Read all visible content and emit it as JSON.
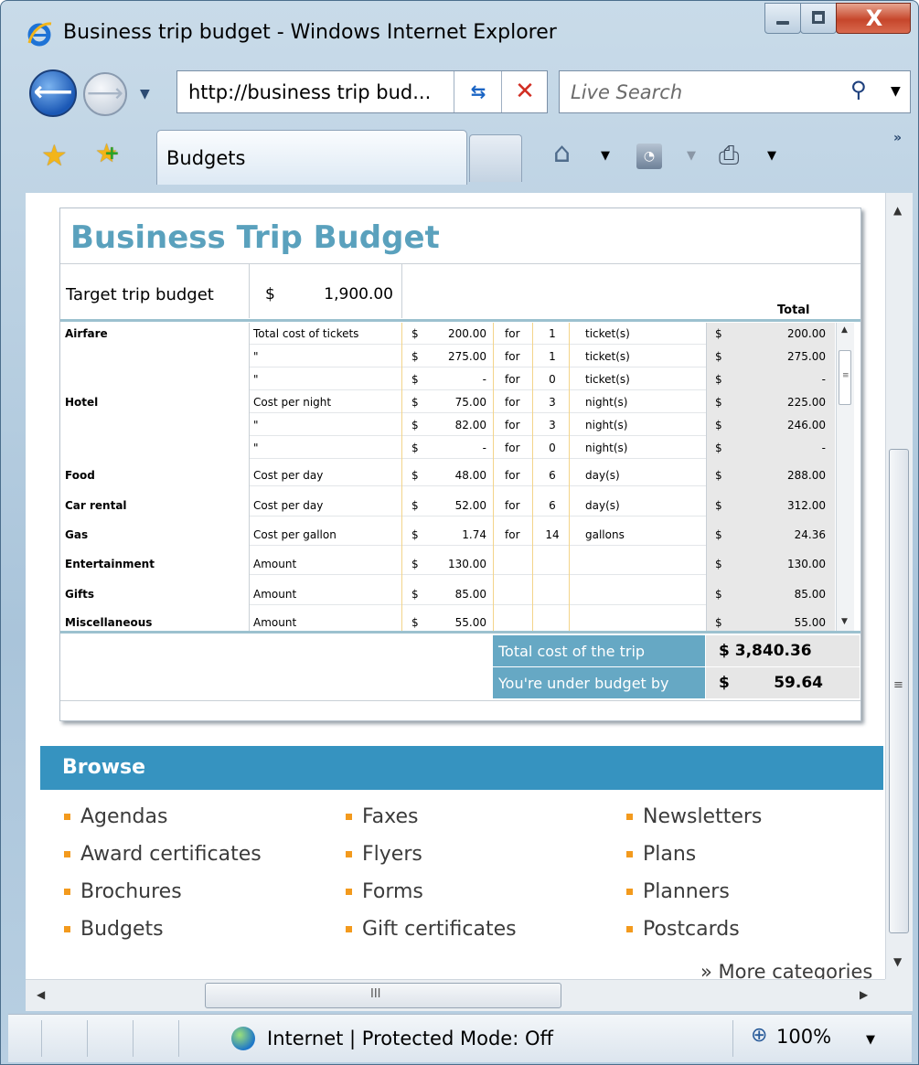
{
  "window": {
    "title": "Business trip budget - Windows Internet Explorer",
    "close_label": "X"
  },
  "nav": {
    "address": "http://business trip bud...",
    "search_placeholder": "Live Search"
  },
  "tabs": {
    "active_label": "Budgets"
  },
  "icons": {
    "back": "back-arrow-icon",
    "forward": "forward-arrow-icon",
    "refresh": "refresh-icon",
    "stop": "stop-icon",
    "search": "search-icon",
    "favorites": "favorites-star-icon",
    "add_favorites": "add-favorites-icon",
    "home": "home-icon",
    "feeds": "feeds-icon",
    "print": "print-icon",
    "zone": "internet-globe-icon",
    "zoom": "zoom-icon"
  },
  "colors": {
    "title": "#5aa1bd",
    "summary_label": "#66a8c4",
    "browse_bar": "#3693c0",
    "bullet": "#f39a1d"
  },
  "budget": {
    "title": "Business Trip Budget",
    "target_label": "Target trip budget",
    "target_currency": "$",
    "target_value": "1,900.00",
    "total_header": "Total",
    "rows": [
      {
        "cat": "Airfare",
        "desc": "Total cost of tickets",
        "cur": "$",
        "amt": "200.00",
        "for": "for",
        "qty": "1",
        "unit": "ticket(s)",
        "tcur": "$",
        "total": "200.00"
      },
      {
        "cat": "",
        "desc": "\"",
        "cur": "$",
        "amt": "275.00",
        "for": "for",
        "qty": "1",
        "unit": "ticket(s)",
        "tcur": "$",
        "total": "275.00"
      },
      {
        "cat": "",
        "desc": "\"",
        "cur": "$",
        "amt": "-",
        "for": "for",
        "qty": "0",
        "unit": "ticket(s)",
        "tcur": "$",
        "total": "-"
      },
      {
        "cat": "Hotel",
        "desc": "Cost per night",
        "cur": "$",
        "amt": "75.00",
        "for": "for",
        "qty": "3",
        "unit": "night(s)",
        "tcur": "$",
        "total": "225.00"
      },
      {
        "cat": "",
        "desc": "\"",
        "cur": "$",
        "amt": "82.00",
        "for": "for",
        "qty": "3",
        "unit": "night(s)",
        "tcur": "$",
        "total": "246.00"
      },
      {
        "cat": "",
        "desc": "\"",
        "cur": "$",
        "amt": "-",
        "for": "for",
        "qty": "0",
        "unit": "night(s)",
        "tcur": "$",
        "total": "-"
      },
      {
        "cat": "Food",
        "desc": "Cost per day",
        "cur": "$",
        "amt": "48.00",
        "for": "for",
        "qty": "6",
        "unit": "day(s)",
        "tcur": "$",
        "total": "288.00"
      },
      {
        "cat": "Car rental",
        "desc": "Cost per day",
        "cur": "$",
        "amt": "52.00",
        "for": "for",
        "qty": "6",
        "unit": "day(s)",
        "tcur": "$",
        "total": "312.00"
      },
      {
        "cat": "Gas",
        "desc": "Cost per gallon",
        "cur": "$",
        "amt": "1.74",
        "for": "for",
        "qty": "14",
        "unit": "gallons",
        "tcur": "$",
        "total": "24.36"
      },
      {
        "cat": "Entertainment",
        "desc": "Amount",
        "cur": "$",
        "amt": "130.00",
        "for": "",
        "qty": "",
        "unit": "",
        "tcur": "$",
        "total": "130.00"
      },
      {
        "cat": "Gifts",
        "desc": "Amount",
        "cur": "$",
        "amt": "85.00",
        "for": "",
        "qty": "",
        "unit": "",
        "tcur": "$",
        "total": "85.00"
      },
      {
        "cat": "Miscellaneous",
        "desc": "Amount",
        "cur": "$",
        "amt": "55.00",
        "for": "",
        "qty": "",
        "unit": "",
        "tcur": "$",
        "total": "55.00"
      }
    ],
    "summary_total_label": "Total cost of the trip",
    "summary_total_value": "$ 3,840.36",
    "summary_under_label": "You're under budget by",
    "summary_under_currency": "$",
    "summary_under_value": "59.64"
  },
  "browse": {
    "title": "Browse",
    "columns": [
      [
        "Agendas",
        "Award certificates",
        "Brochures",
        "Budgets"
      ],
      [
        "Faxes",
        "Flyers",
        "Forms",
        "Gift certificates"
      ],
      [
        "Newsletters",
        "Plans",
        "Planners",
        "Postcards"
      ]
    ],
    "more_label": "» More categories"
  },
  "hscroll_grip": "III",
  "status": {
    "zone_text": "Internet | Protected Mode: Off",
    "zoom": "100%"
  }
}
